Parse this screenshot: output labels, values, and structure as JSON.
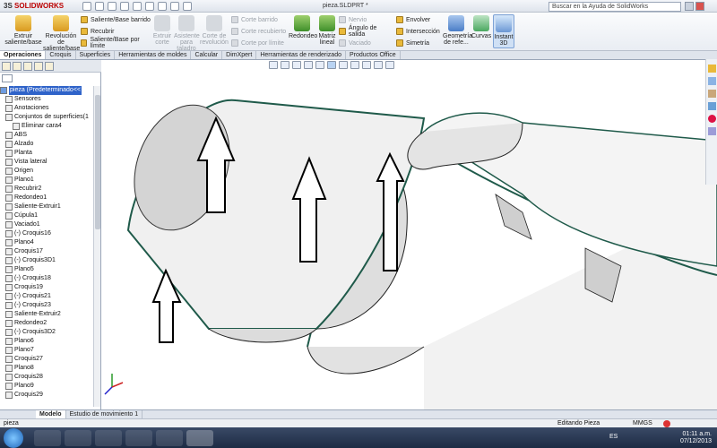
{
  "app": {
    "logo_prefix": "3S",
    "logo_name": "SOLIDWORKS",
    "window_title": "pieza.SLDPRT *"
  },
  "search": {
    "placeholder": "Buscar en la Ayuda de SolidWorks"
  },
  "ribbon": {
    "extrude_boss": "Extruir saliente/base",
    "revolve_boss": "Revolución de saliente/base",
    "swept_boss": "Saliente/Base barrido",
    "loft_boss": "Recubrir",
    "boundary_boss": "Saliente/Base por límite",
    "extrude_cut": "Extruir corte",
    "hole_wizard": "Asistente para taladro",
    "revolve_cut": "Corte de revolución",
    "swept_cut": "Corte barrido",
    "lofted_cut": "Corte recubierto",
    "boundary_cut": "Corte por límite",
    "fillet": "Redondeo",
    "linear_pattern": "Matriz lineal",
    "rib": "Nervio",
    "draft": "Ángulo de salida",
    "shell": "Vaciado",
    "wrap": "Envolver",
    "intersect": "Intersección",
    "mirror": "Simetría",
    "reference_geometry": "Geometría de refe...",
    "curves": "Curvas",
    "instant3d": "Instant 3D"
  },
  "tabs": [
    "Operaciones",
    "Croquis",
    "Superficies",
    "Herramientas de moldes",
    "Calcular",
    "DimXpert",
    "Herramientas de renderizado",
    "Productos Office"
  ],
  "tree": {
    "root": "pieza (Predeterminado<<",
    "items": [
      "Sensores",
      "Anotaciones",
      "Conjuntos de superficies(1",
      "Eliminar cara4",
      "ABS",
      "Alzado",
      "Planta",
      "Vista lateral",
      "Origen",
      "Plano1",
      "Recubrir2",
      "Redondeo1",
      "Saliente-Extruir1",
      "Cúpula1",
      "Vaciado1",
      "(-) Croquis16",
      "Plano4",
      "Croquis17",
      "(-) Croquis3D1",
      "Plano5",
      "(-) Croquis18",
      "Croquis19",
      "(-) Croquis21",
      "(-) Croquis23",
      "Saliente-Extruir2",
      "Redondeo2",
      "(-) Croquis3D2",
      "Plano6",
      "Plano7",
      "Croquis27",
      "Plano8",
      "Croquis28",
      "Plano9",
      "Croquis29"
    ]
  },
  "bottom_tabs": [
    "Modelo",
    "Estudio de movimiento 1"
  ],
  "status": {
    "left": "pieza",
    "mode": "Editando Pieza",
    "units": "MMGS"
  },
  "taskbar": {
    "lang": "ES",
    "time": "01:11 a.m.",
    "date": "07/12/2013"
  }
}
